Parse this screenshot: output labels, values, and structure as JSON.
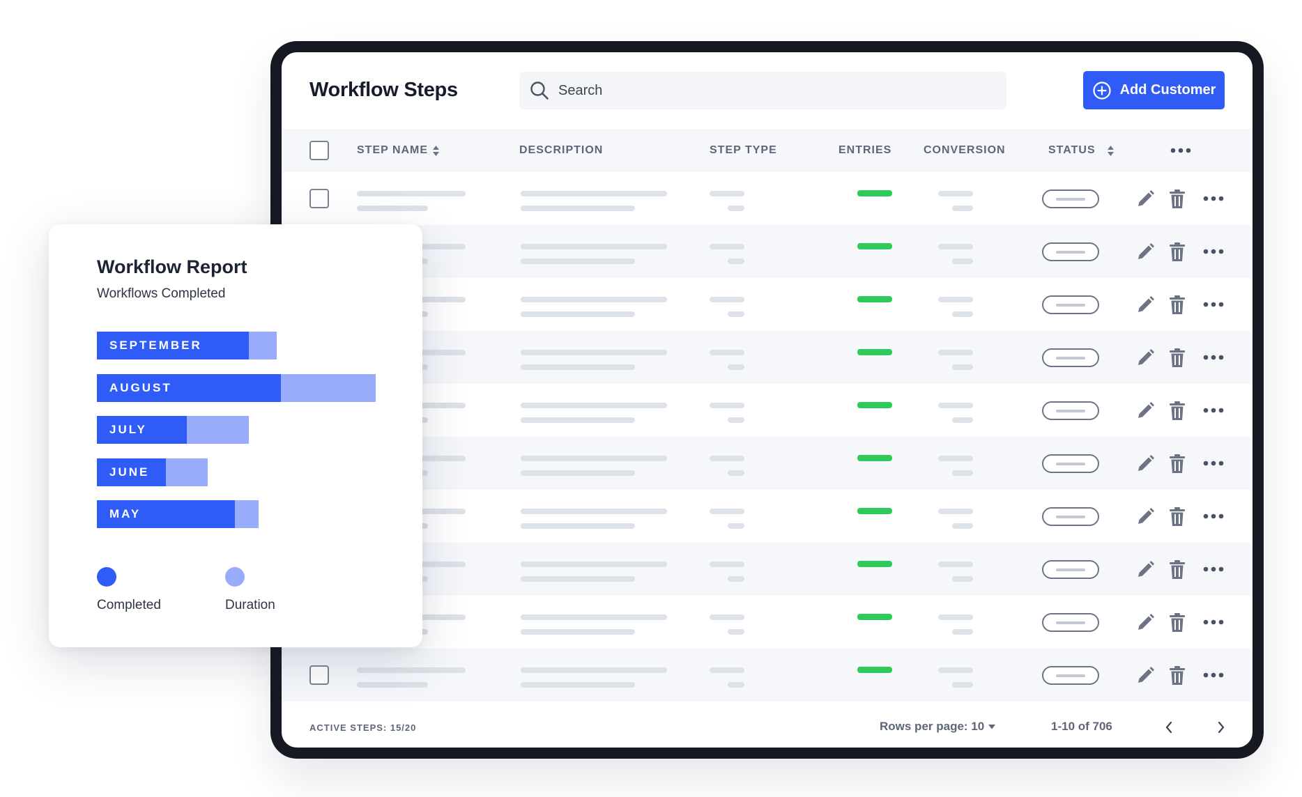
{
  "header": {
    "title": "Workflow Steps",
    "search_placeholder": "Search",
    "add_button_label": "Add Customer"
  },
  "table": {
    "columns": [
      "STEP NAME",
      "DESCRIPTION",
      "STEP TYPE",
      "ENTRIES",
      "CONVERSION",
      "STATUS"
    ],
    "row_count": 10
  },
  "footer": {
    "active_steps": "ACTIVE STEPS: 15/20",
    "rows_per_page": "Rows per page: 10",
    "range": "1-10 of 706"
  },
  "report": {
    "title": "Workflow Report",
    "subtitle": "Workflows Completed",
    "legend": [
      {
        "label": "Completed",
        "color": "#2f5cf7"
      },
      {
        "label": "Duration",
        "color": "#98acfb"
      }
    ]
  },
  "chart_data": {
    "type": "bar",
    "orientation": "horizontal",
    "categories": [
      "SEPTEMBER",
      "AUGUST",
      "JULY",
      "JUNE",
      "MAY"
    ],
    "series": [
      {
        "name": "Completed",
        "values": [
          218,
          264,
          129,
          99,
          198
        ]
      },
      {
        "name": "Duration",
        "values": [
          258,
          400,
          218,
          159,
          232
        ]
      }
    ],
    "xlim": [
      0,
      400
    ],
    "legend": "bottom",
    "grid": false
  },
  "colors": {
    "accent": "#2f5cf7",
    "accent_light": "#98acfb",
    "entries_bar": "#2fcb5a"
  }
}
